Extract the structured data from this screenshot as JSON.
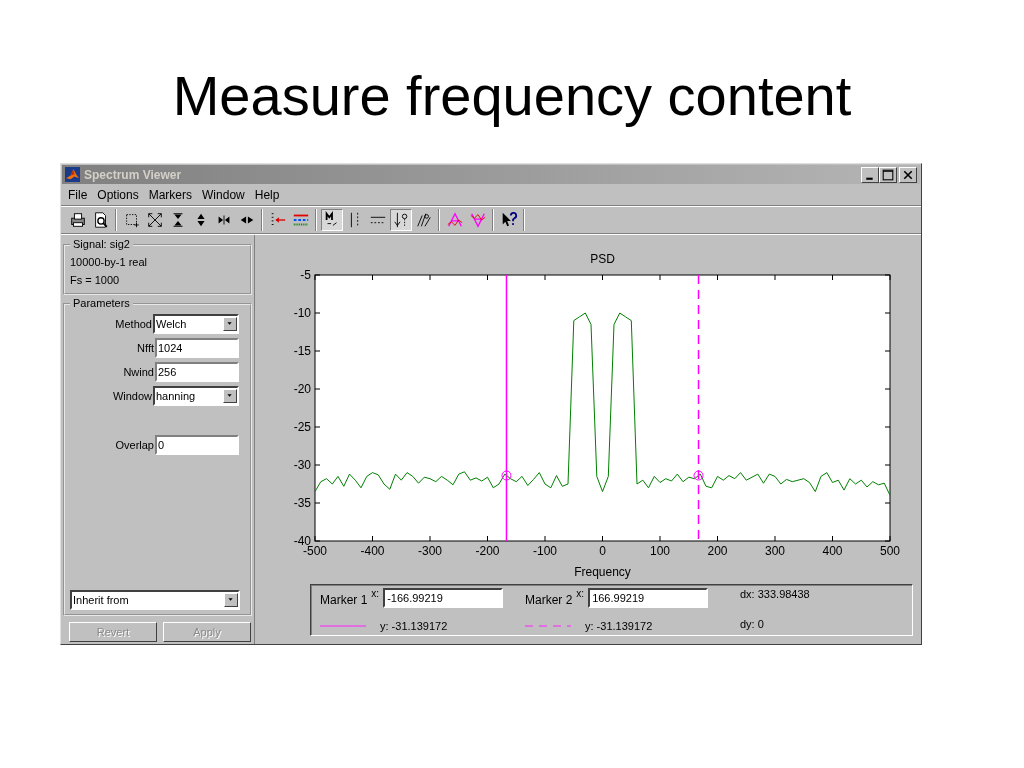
{
  "slide_title": "Measure frequency content",
  "window": {
    "title": "Spectrum Viewer",
    "active": false
  },
  "menu": [
    "File",
    "Options",
    "Markers",
    "Window",
    "Help"
  ],
  "toolbar": [
    [
      {
        "kind": "print",
        "pressed": false
      },
      {
        "kind": "preview",
        "pressed": false
      }
    ],
    [
      {
        "kind": "zoombox",
        "pressed": false
      },
      {
        "kind": "fullview",
        "pressed": false
      },
      {
        "kind": "vzoomin",
        "pressed": false
      },
      {
        "kind": "vzoomout",
        "pressed": false
      },
      {
        "kind": "hzoomin",
        "pressed": false
      },
      {
        "kind": "hzoomout",
        "pressed": false
      }
    ],
    [
      {
        "kind": "select",
        "pressed": false
      },
      {
        "kind": "lines",
        "pressed": false
      }
    ],
    [
      {
        "kind": "markers",
        "pressed": true
      },
      {
        "kind": "vertical",
        "pressed": false
      },
      {
        "kind": "horizontal",
        "pressed": false
      },
      {
        "kind": "track",
        "pressed": true
      },
      {
        "kind": "free",
        "pressed": false
      }
    ],
    [
      {
        "kind": "peaks",
        "pressed": false
      },
      {
        "kind": "valleys",
        "pressed": false
      }
    ],
    [
      {
        "kind": "help",
        "pressed": false
      }
    ]
  ],
  "signal": {
    "title": "Signal: sig2",
    "lines": [
      "10000-by-1 real",
      "Fs = 1000"
    ]
  },
  "parameters": {
    "title": "Parameters",
    "fields": [
      {
        "label": "Method",
        "kind": "dropdown",
        "value": "Welch"
      },
      {
        "label": "Nfft",
        "kind": "text",
        "value": "1024"
      },
      {
        "label": "Nwind",
        "kind": "text",
        "value": "256"
      },
      {
        "label": "Window",
        "kind": "dropdown",
        "value": "hanning"
      },
      {
        "label": "Overlap",
        "kind": "text",
        "value": "0"
      }
    ],
    "inherit": {
      "kind": "dropdown",
      "value": "Inherit from"
    }
  },
  "buttons": [
    {
      "label": "Revert",
      "disabled": true
    },
    {
      "label": "Apply",
      "disabled": true
    }
  ],
  "plot": {
    "chart_data": {
      "type": "line",
      "title": "PSD",
      "xlabel": "Frequency",
      "x": [
        -500,
        -490,
        -480,
        -470,
        -460,
        -450,
        -440,
        -430,
        -420,
        -410,
        -400,
        -390,
        -380,
        -370,
        -360,
        -350,
        -340,
        -330,
        -320,
        -310,
        -300,
        -290,
        -280,
        -270,
        -260,
        -250,
        -240,
        -230,
        -220,
        -210,
        -200,
        -190,
        -180,
        -170,
        -160,
        -150,
        -140,
        -130,
        -120,
        -110,
        -100,
        -90,
        -80,
        -70,
        -60,
        -50,
        -40,
        -30,
        -20,
        -10,
        0,
        10,
        20,
        30,
        40,
        50,
        60,
        70,
        80,
        90,
        100,
        110,
        120,
        130,
        140,
        150,
        160,
        170,
        180,
        190,
        200,
        210,
        220,
        230,
        240,
        250,
        260,
        270,
        280,
        290,
        300,
        310,
        320,
        330,
        340,
        350,
        360,
        370,
        380,
        390,
        400,
        410,
        420,
        430,
        440,
        450,
        460,
        470,
        480,
        490,
        500
      ],
      "series": [
        {
          "color": "#008000",
          "values": [
            -33.5,
            -32.2,
            -31.8,
            -32.5,
            -31.5,
            -32.8,
            -31.2,
            -32,
            -33,
            -31.5,
            -31,
            -31.3,
            -32.5,
            -33.2,
            -31.2,
            -32,
            -31,
            -31.5,
            -32.4,
            -31.6,
            -31.8,
            -32.2,
            -31.5,
            -32,
            -32.6,
            -31.2,
            -30.9,
            -32,
            -31.7,
            -32.1,
            -31.6,
            -33,
            -32.5,
            -31.2,
            -31.8,
            -32.2,
            -31.5,
            -32.7,
            -31.9,
            -31,
            -32.5,
            -33,
            -31.4,
            -32.8,
            -32.5,
            -11,
            -10.5,
            -10,
            -11.5,
            -31.5,
            -33.5,
            -31.5,
            -11.5,
            -10,
            -10.5,
            -11,
            -32.5,
            -32,
            -33,
            -31.5,
            -32.3,
            -31.8,
            -32.1,
            -31.2,
            -32.2,
            -31.6,
            -31.8,
            -31.2,
            -32.8,
            -33,
            -31.5,
            -32,
            -31.4,
            -31.8,
            -31,
            -32,
            -31.6,
            -31.2,
            -32.4,
            -31.2,
            -31.5,
            -32.5,
            -31.9,
            -32.2,
            -32,
            -31.8,
            -32.3,
            -33.5,
            -31.5,
            -31,
            -32.3,
            -32,
            -33.3,
            -31.8,
            -32.5,
            -32,
            -32.9,
            -32.2,
            -32.6,
            -32.4,
            -34
          ]
        }
      ],
      "xlim": [
        -500,
        500
      ],
      "ylim": [
        -40,
        -5
      ],
      "xticks": [
        -500,
        -400,
        -300,
        -200,
        -100,
        0,
        100,
        200,
        300,
        400,
        500
      ],
      "yticks": [
        -40,
        -35,
        -30,
        -25,
        -20,
        -15,
        -10,
        -5
      ],
      "ref_lines": [
        {
          "axis": "x",
          "value": -166.99219
        },
        {
          "axis": "x",
          "value": 166.99219
        }
      ]
    }
  },
  "markers": [
    {
      "label": "Marker 1",
      "x_label": "x:",
      "x_value": "-166.99219",
      "y_text": "y: -31.139172",
      "dashed": false
    },
    {
      "label": "Marker 2",
      "x_label": "x:",
      "x_value": "166.99219",
      "y_text": "y: -31.139172",
      "dashed": true
    }
  ],
  "delta": [
    "dx: 333.98438",
    "dy: 0"
  ]
}
